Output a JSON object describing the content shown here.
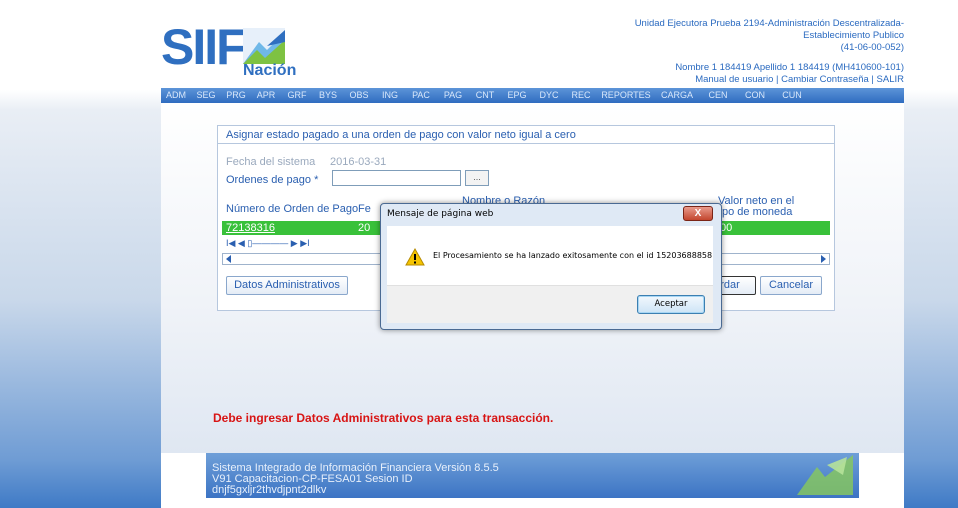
{
  "header": {
    "logo_letters": "SIIF",
    "logo_sub": "Nación",
    "unit_line1": "Unidad Ejecutora Prueba 2194-Administración Descentralizada-",
    "unit_line2": "Establecimiento Publico",
    "unit_line3": "(41-06-00-052)",
    "user_line": "Nombre 1 184419 Apellido 1 184419 (MH410600-101)",
    "link_manual": "Manual de usuario",
    "sep1": "|",
    "link_password": "Cambiar Contraseña",
    "sep2": "|",
    "link_exit": "SALIR"
  },
  "menu": [
    "ADM",
    "SEG",
    "PRG",
    "APR",
    "GRF",
    "BYS",
    "OBS",
    "ING",
    "PAC",
    "PAG",
    "CNT",
    "EPG",
    "DYC",
    "REC",
    "REPORTES",
    "CARGA",
    "CEN",
    "CON",
    "CUN"
  ],
  "panel": {
    "title": "Asignar estado pagado a una orden de pago con valor neto igual a cero",
    "fecha_label": "Fecha del sistema",
    "fecha_value": "2016-03-31",
    "ordenes_label": "Ordenes de pago *",
    "ordenes_value": "",
    "browse_label": "...",
    "columns": {
      "numero": "Número de Orden de Pago",
      "fecha": "Fe",
      "nombre_line1": "Nombre o Razón",
      "valor_line1": "Valor neto en el",
      "valor_line2": "po de moneda"
    },
    "row": {
      "numero": "72138316",
      "fecha": "20",
      "valor": "00"
    },
    "pager": "I◀ ◀ ▯———— ▶ ▶I",
    "btn_datos": "Datos Administrativos",
    "btn_guardar": "ardar",
    "btn_cancelar": "Cancelar"
  },
  "error_message": "Debe ingresar Datos Administrativos para esta transacción.",
  "footer": {
    "line1": "Sistema Integrado de Información Financiera Versión 8.5.5",
    "line2": "V91 Capacitacion-CP-FESA01 Sesion ID",
    "line3": "dnjf5gxljr2thvdjpnt2dlkv"
  },
  "dialog": {
    "title": "Mensaje de página web",
    "close": "X",
    "message": "El Procesamiento se ha lanzado exitosamente con el id 15203688858",
    "ok": "Aceptar"
  },
  "colors": {
    "brand_blue": "#2f6fc0",
    "row_green": "#39c13a",
    "error_red": "#d81414"
  }
}
